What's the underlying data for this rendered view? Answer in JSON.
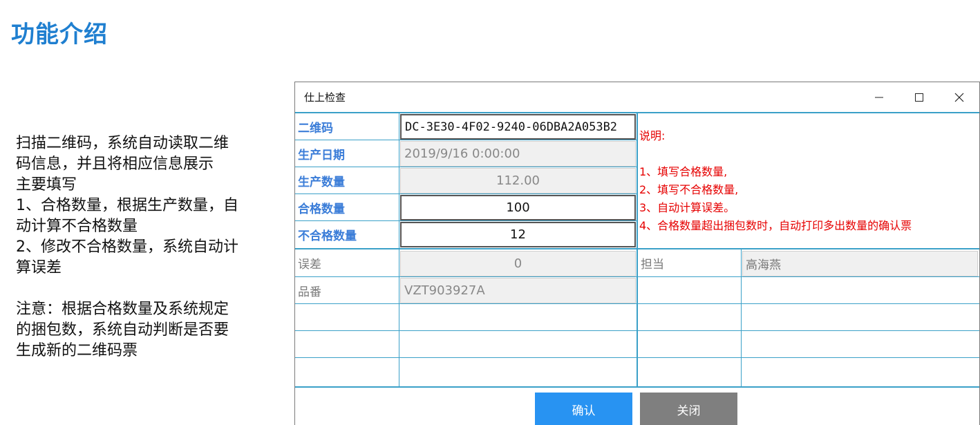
{
  "slide": {
    "title": "功能介绍",
    "intro_lines": [
      "扫描二维码，系统自动读取二维",
      "码信息，并且将相应信息展示",
      "主要填写",
      "1、合格数量，根据生产数量，自",
      "动计算不合格数量",
      "2、修改不合格数量，系统自动计",
      "算误差"
    ],
    "note_lines": [
      "注意：根据合格数量及系统规定",
      "的捆包数，系统自动判断是否要",
      "生成新的二维码票"
    ]
  },
  "dialog": {
    "title": "仕上检查",
    "window_buttons": {
      "minimize": "minimize-icon",
      "maximize": "maximize-icon",
      "close": "close-icon"
    },
    "fields": {
      "qrcode": {
        "label": "二维码",
        "value": "DC-3E30-4F02-9240-06DBA2A053B2"
      },
      "production_date": {
        "label": "生产日期",
        "value": "2019/9/16 0:00:00"
      },
      "production_qty": {
        "label": "生产数量",
        "value": "112.00"
      },
      "pass_qty": {
        "label": "合格数量",
        "value": "100"
      },
      "fail_qty": {
        "label": "不合格数量",
        "value": "12"
      },
      "error": {
        "label": "误差",
        "value": "0"
      },
      "part_no": {
        "label": "品番",
        "value": "VZT903927A"
      },
      "owner": {
        "label": "担当",
        "value": "高海燕"
      }
    },
    "instructions": {
      "heading": "说明:",
      "items": [
        "1、填写合格数量,",
        "2、填写不合格数量,",
        "3、自动计算误差。",
        "4、合格数量超出捆包数时，自动打印多出数量的确认票"
      ]
    },
    "buttons": {
      "confirm": "确认",
      "close": "关闭"
    },
    "colors": {
      "label_blue": "#3b7dd8",
      "grid_line": "#3aa0c8",
      "note_red": "#e60000",
      "confirm_bg": "#2893f2",
      "close_bg": "#7f7f7f"
    }
  }
}
